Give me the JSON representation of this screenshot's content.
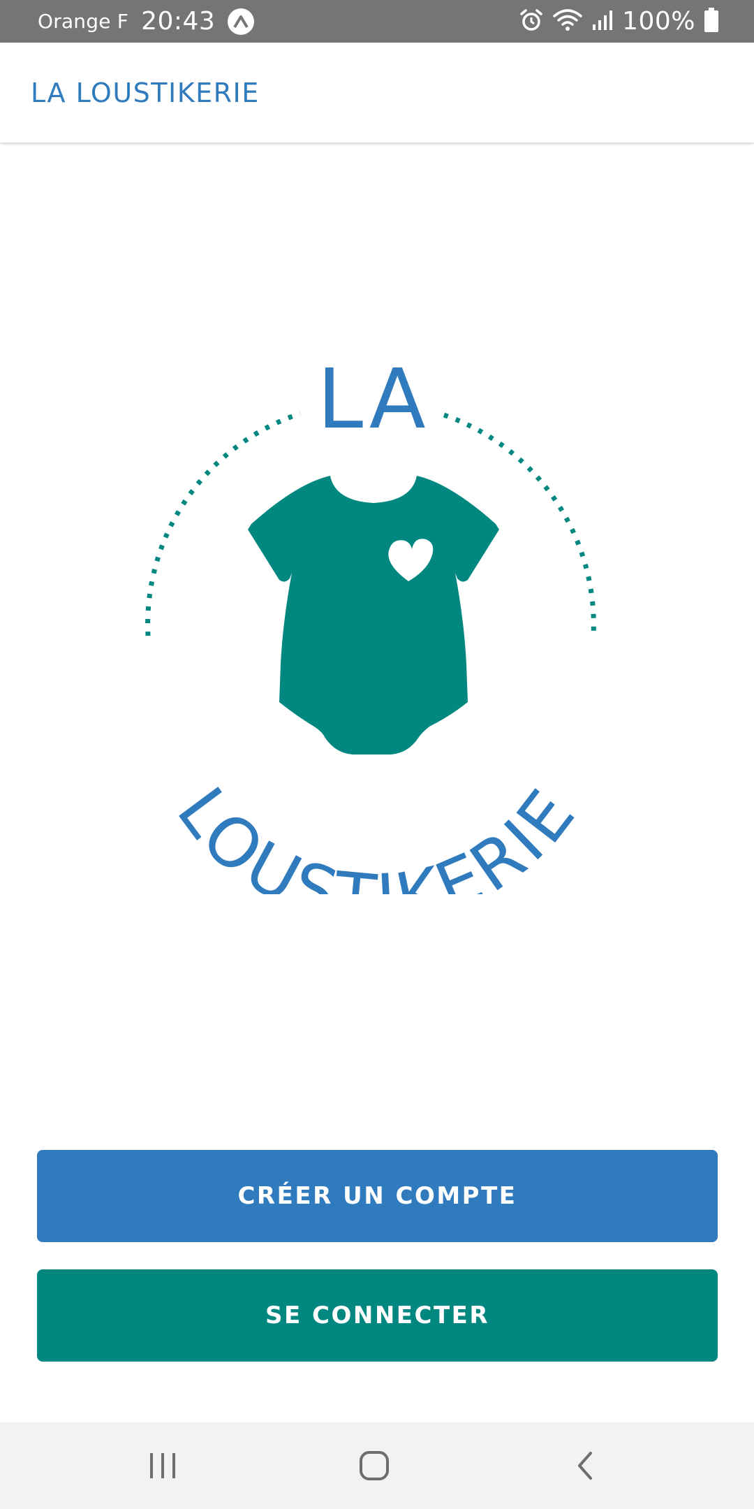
{
  "status_bar": {
    "carrier": "Orange F",
    "time": "20:43",
    "battery": "100%",
    "icons": [
      "a-badge-icon",
      "alarm-icon",
      "wifi-icon",
      "signal-icon",
      "battery-icon"
    ]
  },
  "app_bar": {
    "title": "LA LOUSTIKERIE"
  },
  "logo": {
    "top_text": "LA",
    "bottom_text": "LOUSTIKERIE",
    "icon": "baby-bodysuit-icon"
  },
  "buttons": {
    "create_account": "CRÉER UN COMPTE",
    "login": "SE CONNECTER"
  },
  "nav_bar": {
    "icons": [
      "recent-apps-icon",
      "home-icon",
      "back-icon"
    ]
  },
  "colors": {
    "brand_blue": "#2f7bbd",
    "brand_teal": "#00877f",
    "status_bar": "#757575",
    "nav_bar": "#f2f2f2"
  }
}
